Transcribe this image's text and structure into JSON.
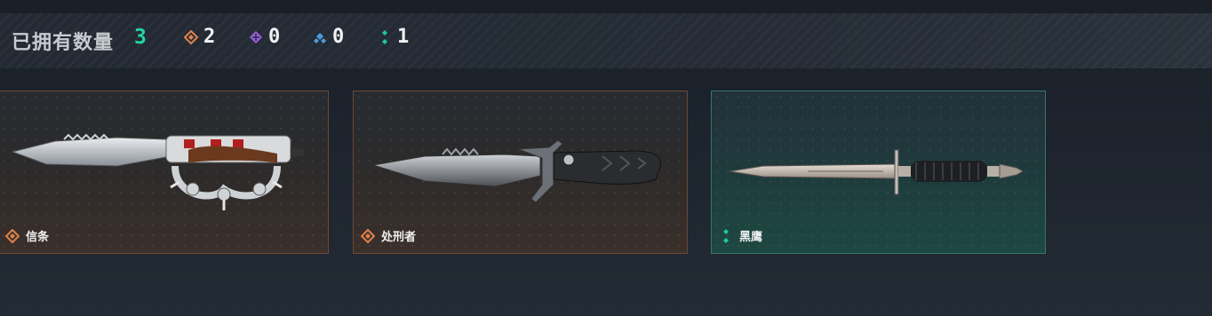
{
  "header": {
    "owned_label": "已拥有数量",
    "owned_count": "3",
    "stats": [
      {
        "icon": "orange-diamond-icon",
        "color": "#e0824a",
        "value": "2"
      },
      {
        "icon": "purple-diamond-icon",
        "color": "#9a5de0",
        "value": "0"
      },
      {
        "icon": "blue-diamond-icon",
        "color": "#4a9be0",
        "value": "0"
      },
      {
        "icon": "green-diamond-icon",
        "color": "#20c99a",
        "value": "1"
      }
    ]
  },
  "items": [
    {
      "name": "信条",
      "rarity": "orange",
      "icon": "orange-diamond-icon",
      "image": "knuckle-knife"
    },
    {
      "name": "处刑者",
      "rarity": "orange",
      "icon": "orange-diamond-icon",
      "image": "tactical-knife"
    },
    {
      "name": "黑鹰",
      "rarity": "teal",
      "icon": "green-diamond-icon",
      "image": "dagger"
    }
  ]
}
